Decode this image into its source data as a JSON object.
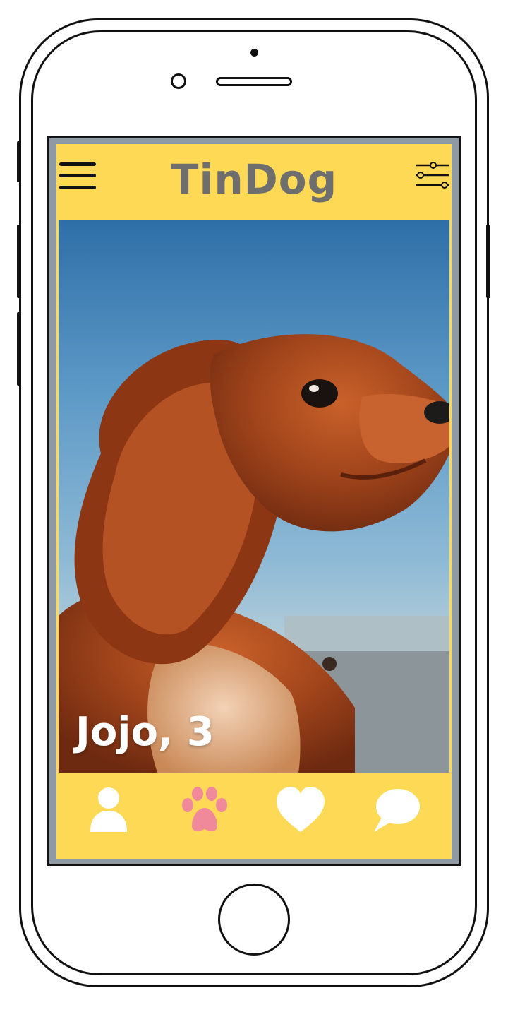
{
  "app": {
    "title": "TinDog",
    "accent_color": "#fdd956",
    "title_color": "#6e6e6e",
    "paw_color": "#f08a9a"
  },
  "header": {
    "menu_icon": "hamburger-menu-icon",
    "filter_icon": "sliders-filter-icon"
  },
  "profile": {
    "name_age": "Jojo, 3",
    "photo_subject": "dog-photo"
  },
  "bottom_nav": {
    "items": [
      {
        "icon": "user-icon",
        "active": false
      },
      {
        "icon": "paw-icon",
        "active": true
      },
      {
        "icon": "heart-icon",
        "active": false
      },
      {
        "icon": "chat-bubble-icon",
        "active": false
      }
    ]
  }
}
